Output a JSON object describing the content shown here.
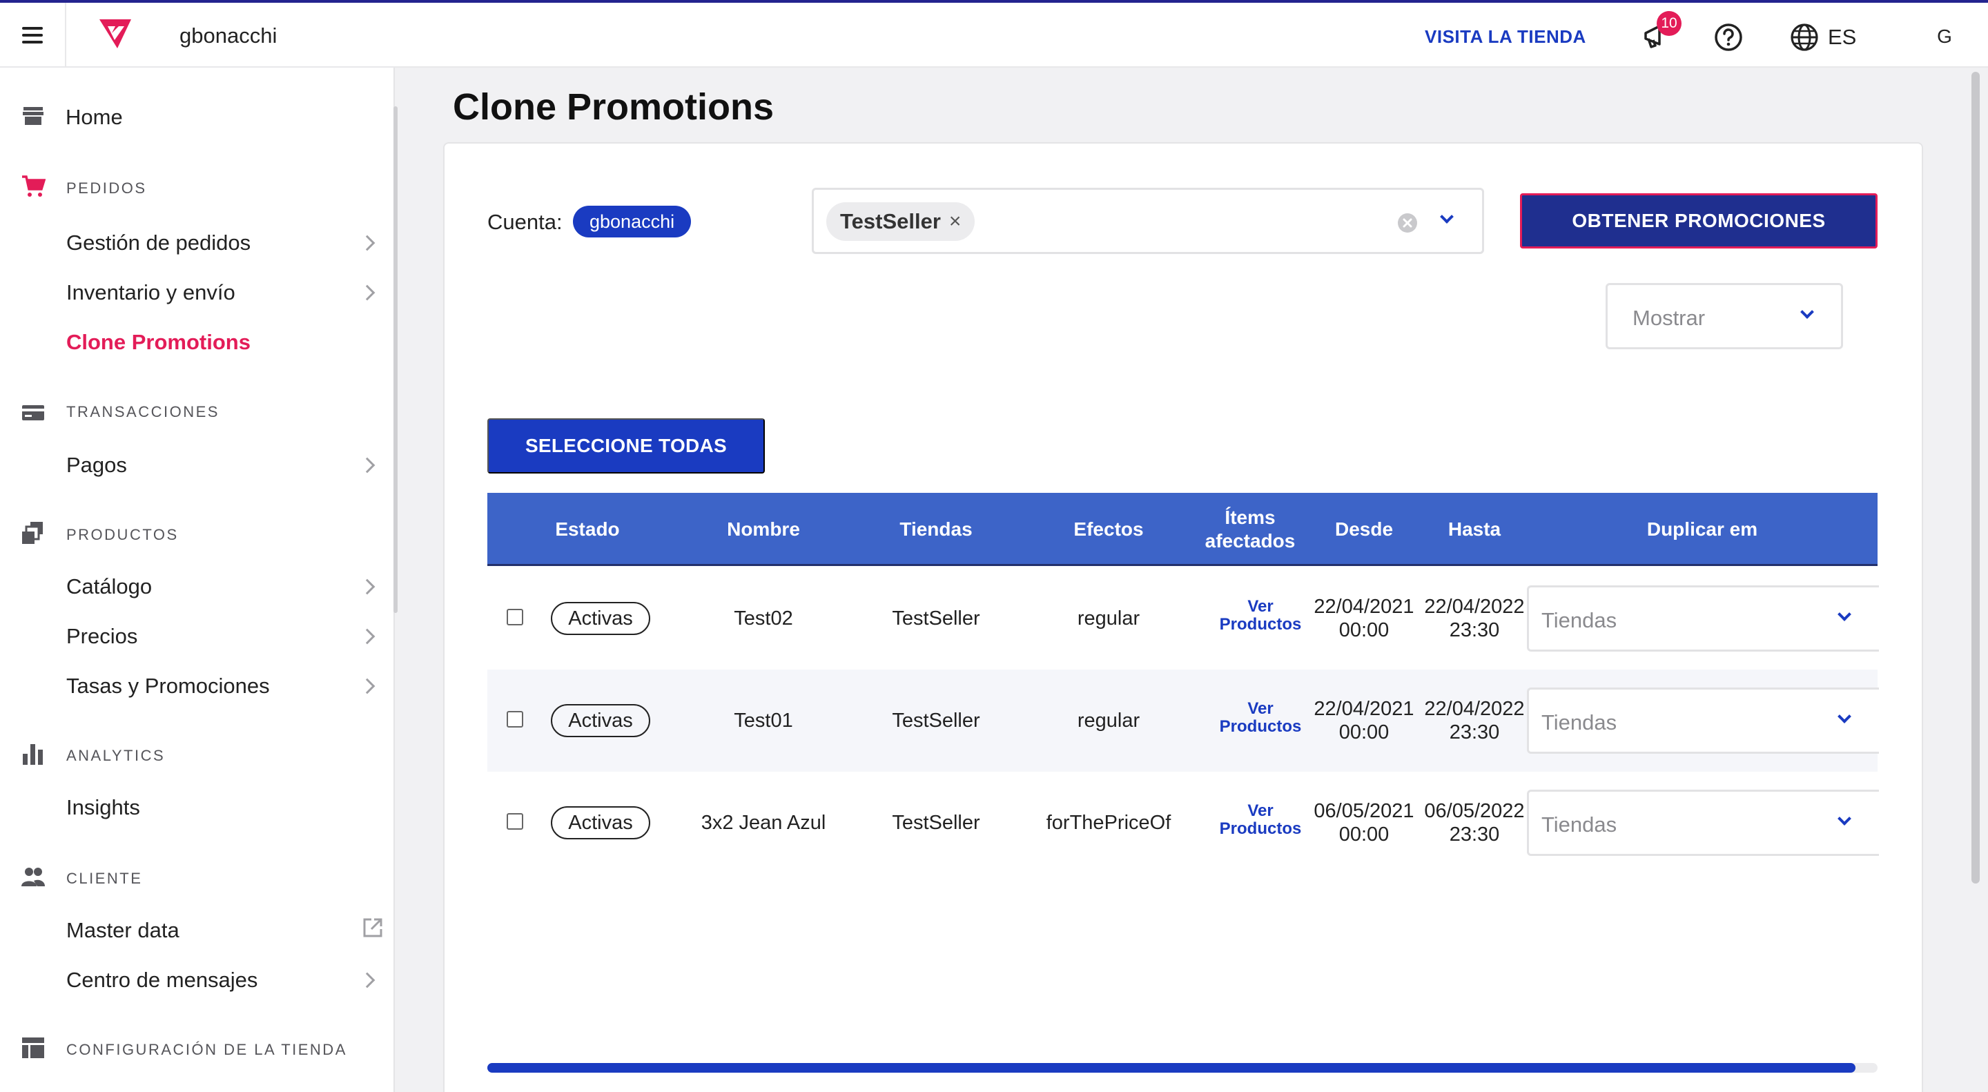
{
  "topbar": {
    "account_name": "gbonacchi",
    "visit_store": "VISITA LA TIENDA",
    "notification_count": "10",
    "language": "ES",
    "avatar_initial": "G"
  },
  "sidebar": {
    "home": "Home",
    "sections": {
      "pedidos": "PEDIDOS",
      "transacciones": "TRANSACCIONES",
      "productos": "PRODUCTOS",
      "analytics": "ANALYTICS",
      "cliente": "CLIENTE",
      "configuracion": "CONFIGURACIÓN DE LA TIENDA"
    },
    "items": {
      "gestion_pedidos": "Gestión de pedidos",
      "inventario": "Inventario y envío",
      "clone_promotions": "Clone Promotions",
      "pagos": "Pagos",
      "catalogo": "Catálogo",
      "precios": "Precios",
      "tasas": "Tasas y Promociones",
      "insights": "Insights",
      "master_data": "Master data",
      "centro_mensajes": "Centro de mensajes"
    }
  },
  "main": {
    "title": "Clone Promotions",
    "cuenta_label": "Cuenta:",
    "cuenta_value": "gbonacchi",
    "seller_chip": "TestSeller",
    "seller_chip_remove": "×",
    "obtener_button": "OBTENER PROMOCIONES",
    "mostrar_placeholder": "Mostrar",
    "select_all_button": "SELECCIONE TODAS"
  },
  "table": {
    "headers": {
      "estado": "Estado",
      "nombre": "Nombre",
      "tiendas": "Tiendas",
      "efectos": "Efectos",
      "items_line1": "Ítems",
      "items_line2": "afectados",
      "desde": "Desde",
      "hasta": "Hasta",
      "duplicar": "Duplicar em"
    },
    "rows": [
      {
        "estado": "Activas",
        "nombre": "Test02",
        "tiendas": "TestSeller",
        "efectos": "regular",
        "ver1": "Ver",
        "ver2": "Productos",
        "desde_date": "22/04/2021",
        "desde_time": "00:00",
        "hasta_date": "22/04/2022",
        "hasta_time": "23:30",
        "duplicar_placeholder": "Tiendas"
      },
      {
        "estado": "Activas",
        "nombre": "Test01",
        "tiendas": "TestSeller",
        "efectos": "regular",
        "ver1": "Ver",
        "ver2": "Productos",
        "desde_date": "22/04/2021",
        "desde_time": "00:00",
        "hasta_date": "22/04/2022",
        "hasta_time": "23:30",
        "duplicar_placeholder": "Tiendas"
      },
      {
        "estado": "Activas",
        "nombre": "3x2 Jean Azul",
        "tiendas": "TestSeller",
        "efectos": "forThePriceOf",
        "ver1": "Ver",
        "ver2": "Productos",
        "desde_date": "06/05/2021",
        "desde_time": "00:00",
        "hasta_date": "06/05/2022",
        "hasta_time": "23:30",
        "duplicar_placeholder": "Tiendas"
      }
    ]
  },
  "colors": {
    "brand_pink": "#e31c58",
    "primary_blue": "#1a3bc1",
    "header_blue": "#3d64c8",
    "dark_blue": "#1f2f8f"
  }
}
